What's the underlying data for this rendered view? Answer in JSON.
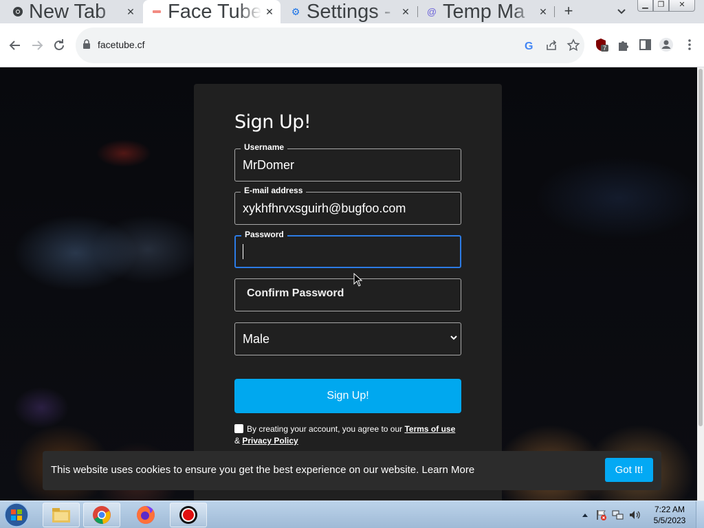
{
  "browser": {
    "tabs": [
      {
        "title": "New Tab",
        "icon": "chrome-icon",
        "active": false
      },
      {
        "title": "Face Tube",
        "icon": "facetube-favicon",
        "active": true
      },
      {
        "title": "Settings - ",
        "icon": "settings-gear-icon",
        "active": false
      },
      {
        "title": "Temp Ma",
        "icon": "temp-mail-icon",
        "active": false
      }
    ],
    "url": "facetube.cf",
    "extension_badge": "7"
  },
  "form": {
    "heading": "Sign Up!",
    "username": {
      "label": "Username",
      "value": "MrDomer"
    },
    "email": {
      "label": "E-mail address",
      "value": "xykhfhrvxsguirh@bugfoo.com"
    },
    "password": {
      "label": "Password",
      "value": ""
    },
    "confirm_password": {
      "placeholder": "Confirm Password"
    },
    "gender": {
      "selected": "Male"
    },
    "submit_label": "Sign Up!",
    "terms": {
      "prefix": "By creating your account, you agree to our ",
      "terms_link": "Terms of use",
      "amp": " & ",
      "privacy_link": "Privacy Policy"
    }
  },
  "cookie_banner": {
    "message": "This website uses cookies to ensure you get the best experience on our website.",
    "learn_more": "Learn More",
    "button": "Got It!"
  },
  "taskbar": {
    "time": "7:22 AM",
    "date": "5/5/2023"
  },
  "colors": {
    "accent": "#00a8ef",
    "focus": "#2c7be5",
    "panel": "#202020",
    "cookie_bg": "#2c2c2c"
  }
}
